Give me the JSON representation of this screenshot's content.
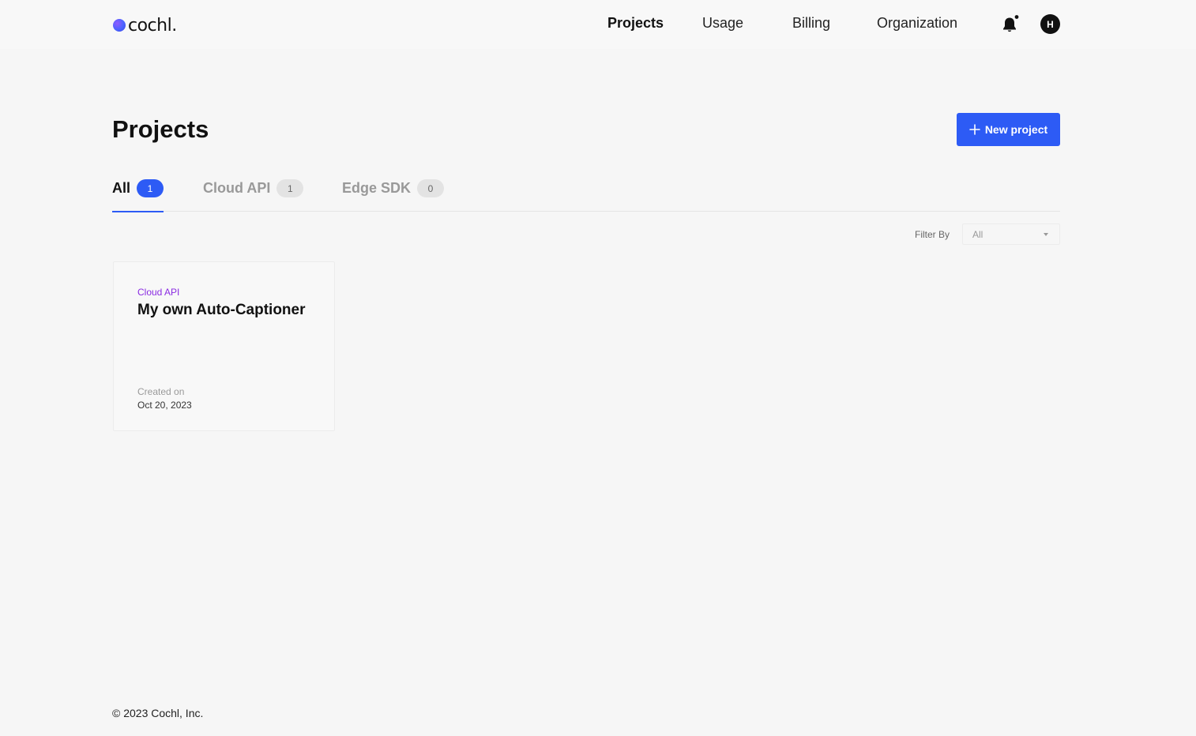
{
  "header": {
    "logo_text": "cochl.",
    "nav": [
      {
        "label": "Projects",
        "active": true
      },
      {
        "label": "Usage",
        "active": false
      },
      {
        "label": "Billing",
        "active": false
      },
      {
        "label": "Organization",
        "active": false
      }
    ],
    "notification_icon": "bell-icon",
    "avatar_initial": "H"
  },
  "main": {
    "title": "Projects",
    "new_project_label": "New project",
    "tabs": [
      {
        "label": "All",
        "count": "1",
        "active": true
      },
      {
        "label": "Cloud API",
        "count": "1",
        "active": false
      },
      {
        "label": "Edge SDK",
        "count": "0",
        "active": false
      }
    ],
    "filter": {
      "label": "Filter By",
      "value": "All"
    },
    "projects": [
      {
        "type": "Cloud API",
        "name": "My own Auto-Captioner",
        "created_label": "Created on",
        "created_date": "Oct 20, 2023"
      }
    ]
  },
  "footer": {
    "copyright": "© 2023 Cochl, Inc."
  },
  "colors": {
    "accent": "#2d5bf5",
    "project_type": "#8a2be2"
  }
}
